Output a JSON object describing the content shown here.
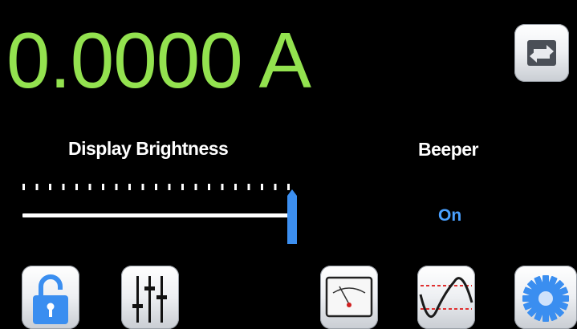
{
  "display": {
    "reading": "0.0000 A"
  },
  "brightness": {
    "label": "Display Brightness",
    "level_fraction": 1.0
  },
  "beeper": {
    "label": "Beeper",
    "value": "On"
  },
  "toolbar": {
    "top_right": "sync-icon",
    "bottom": [
      "unlock-icon",
      "mixer-sliders-icon",
      "analog-meter-icon",
      "waveform-icon",
      "gear-icon"
    ]
  },
  "colors": {
    "reading": "#93e24f",
    "accent": "#4aa0ff",
    "background": "#000000",
    "label": "#ffffff"
  }
}
